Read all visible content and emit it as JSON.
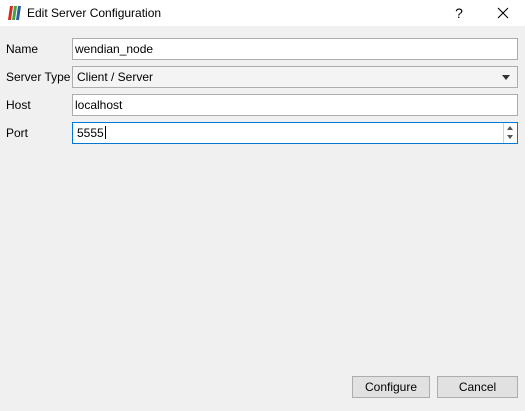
{
  "window": {
    "title": "Edit Server Configuration",
    "help_label": "?",
    "icons": {
      "app": "paraview-logo-icon",
      "close": "close-icon"
    }
  },
  "form": {
    "name_label": "Name",
    "name_value": "wendian_node",
    "server_type_label": "Server Type",
    "server_type_value": "Client / Server",
    "host_label": "Host",
    "host_value": "localhost",
    "port_label": "Port",
    "port_value": "5555"
  },
  "buttons": {
    "configure_label": "Configure",
    "cancel_label": "Cancel"
  },
  "colors": {
    "background": "#f0f0f0",
    "focus_border": "#0078d7",
    "logo_red": "#d42b1e",
    "logo_green": "#46a23c",
    "logo_blue": "#2c5da8"
  }
}
